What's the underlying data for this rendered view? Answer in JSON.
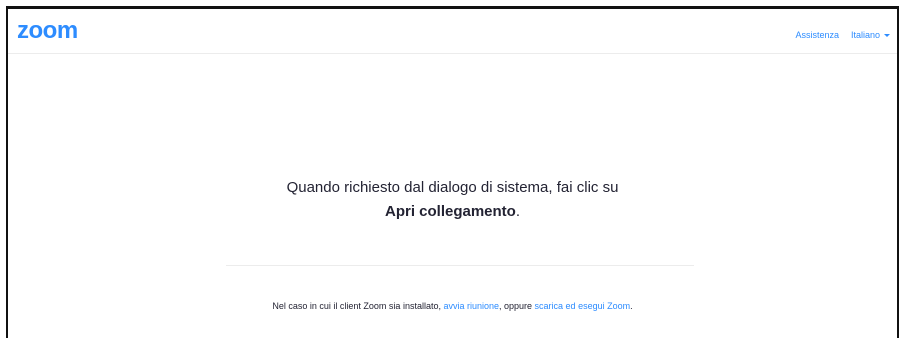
{
  "header": {
    "logo_text": "zoom",
    "support_label": "Assistenza",
    "language_label": "Italiano"
  },
  "main": {
    "line1": "Quando richiesto dal dialogo di sistema, fai clic su",
    "action_bold": "Apri collegamento",
    "action_suffix": "."
  },
  "footer": {
    "prefix": "Nel caso in cui il client Zoom sia installato, ",
    "launch_link": "avvia riunione",
    "middle": ", oppure ",
    "download_link": "scarica ed esegui Zoom",
    "suffix": "."
  },
  "colors": {
    "brand": "#2d8cff",
    "text": "#232333"
  },
  "icons": {
    "language_dropdown": "chevron-down-icon"
  }
}
